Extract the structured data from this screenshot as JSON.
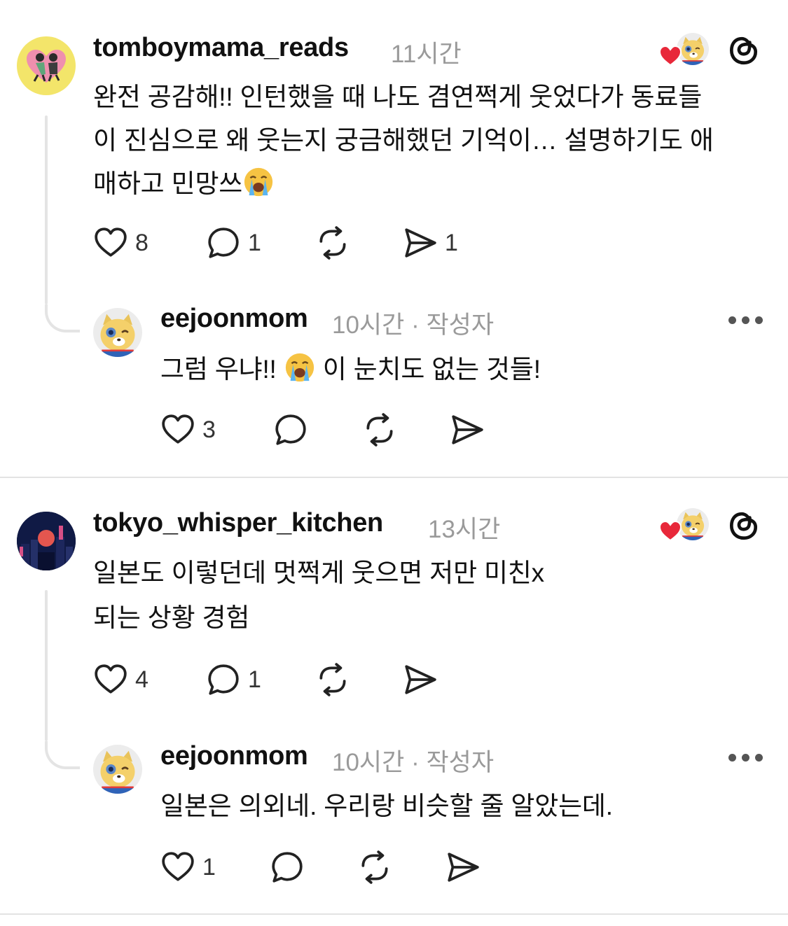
{
  "comments": [
    {
      "username": "tomboymama_reads",
      "time": "11시간",
      "lines": [
        "완전 공감해!! 인턴했을 때 나도 겸연쩍게 웃었다가 동료들",
        "이 진심으로 왜 웃는지 궁금해했던 기억이… 설명하기도 애",
        "매하고 민망쓰"
      ],
      "likes": "8",
      "replies": "1",
      "shares": "1",
      "reply": {
        "username": "eejoonmom",
        "time": "10시간",
        "author_label": "· 작성자",
        "text_before": "그럼 우냐!! ",
        "text_after": " 이 눈치도 없는 것들!",
        "likes": "3"
      }
    },
    {
      "username": "tokyo_whisper_kitchen",
      "time": "13시간",
      "lines": [
        "일본도 이렇던데 멋쩍게 웃으면 저만 미친x",
        "되는 상황 경험"
      ],
      "likes": "4",
      "replies": "1",
      "reply": {
        "username": "eejoonmom",
        "time": "10시간",
        "author_label": "· 작성자",
        "text": "일본은 의외네. 우리랑 비슷할 줄 알았는데.",
        "likes": "1"
      }
    }
  ],
  "colors": {
    "heart": "#e8283a",
    "meta": "#9a9a9a",
    "divider": "#e3e3e3"
  },
  "icons": [
    "heart-icon",
    "comment-icon",
    "repost-icon",
    "share-icon",
    "threads-logo-icon",
    "more-icon",
    "crying-emoji-icon"
  ]
}
